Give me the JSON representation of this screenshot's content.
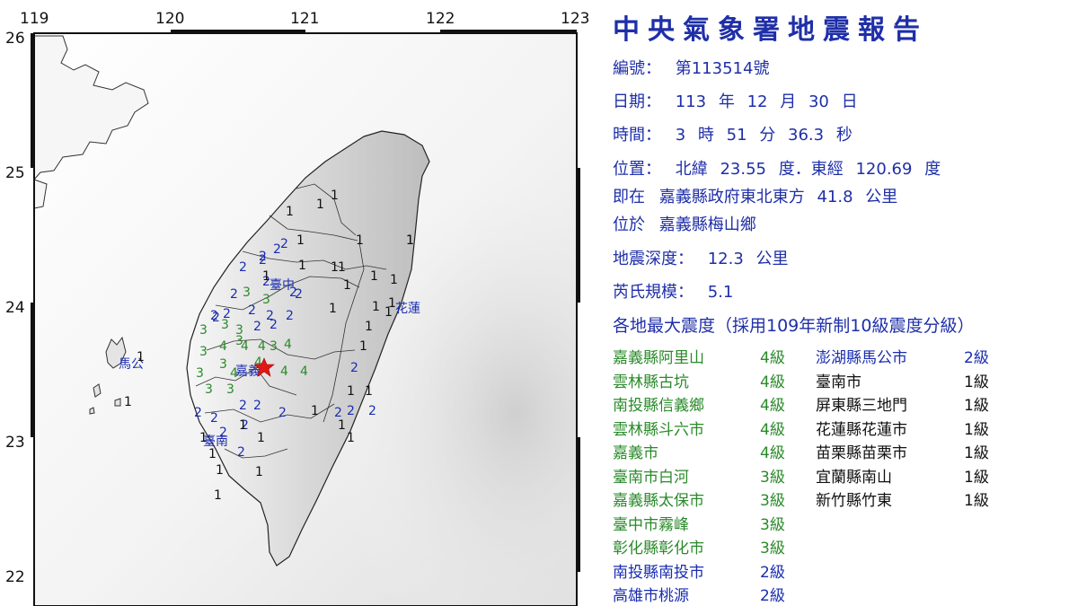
{
  "map": {
    "lon_ticks": [
      "119",
      "120",
      "121",
      "122",
      "123"
    ],
    "lat_ticks": [
      "26",
      "25",
      "24",
      "23",
      "22"
    ],
    "cities": [
      "臺中",
      "花蓮",
      "嘉義",
      "臺南",
      "馬公"
    ],
    "colors": {
      "level4": "#2a8a2a",
      "level3": "#2a8a2a",
      "level2": "#1a2db0",
      "level1": "#111111",
      "epicenter": "#e01818"
    },
    "intensity_marks": [
      "4",
      "4",
      "4",
      "4",
      "4",
      "4",
      "4",
      "4",
      "3",
      "3",
      "3",
      "3",
      "3",
      "3",
      "3",
      "3",
      "3",
      "3",
      "3",
      "3",
      "2",
      "2",
      "2",
      "2",
      "2",
      "2",
      "2",
      "2",
      "2",
      "2",
      "2",
      "2",
      "2",
      "2",
      "2",
      "2",
      "2",
      "2",
      "2",
      "2",
      "2",
      "2",
      "2",
      "2",
      "2",
      "2",
      "2",
      "2",
      "2",
      "1",
      "1",
      "1",
      "1",
      "1",
      "1",
      "1",
      "1",
      "1",
      "1",
      "1",
      "1",
      "1",
      "1",
      "1",
      "1",
      "1",
      "1",
      "1",
      "1",
      "1",
      "1",
      "1",
      "1",
      "1",
      "1",
      "1",
      "1",
      "1",
      "1",
      "1",
      "1",
      "1",
      "1"
    ]
  },
  "report": {
    "title": "中央氣象署地震報告",
    "number_label": "編號：",
    "number": "第113514號",
    "date_label": "日期：",
    "date_year": "113",
    "date_year_unit": "年",
    "date_month": "12",
    "date_month_unit": "月",
    "date_day": "30",
    "date_day_unit": "日",
    "time_label": "時間：",
    "time_h": "3",
    "time_h_unit": "時",
    "time_m": "51",
    "time_m_unit": "分",
    "time_s": "36.3",
    "time_s_unit": "秒",
    "location_label": "位置：",
    "lat_prefix": "北緯",
    "lat": "23.55",
    "lat_unit": "度．東經",
    "lon": "120.69",
    "lon_unit": "度",
    "ref_label": "即在",
    "ref_place": "嘉義縣政府東北東方",
    "ref_distance": "41.8",
    "ref_unit": "公里",
    "at_label": "位於",
    "at_place": "嘉義縣梅山鄉",
    "depth_label": "地震深度：",
    "depth": "12.3",
    "depth_unit": "公里",
    "magnitude_label": "芮氏規模：",
    "magnitude": "5.1",
    "intensity_heading": "各地最大震度（採用109年新制10級震度分級）",
    "intensity_list_left": [
      {
        "place": "嘉義縣阿里山",
        "level": "4級",
        "color": "#2a8a2a"
      },
      {
        "place": "雲林縣古坑",
        "level": "4級",
        "color": "#2a8a2a"
      },
      {
        "place": "南投縣信義鄉",
        "level": "4級",
        "color": "#2a8a2a"
      },
      {
        "place": "雲林縣斗六市",
        "level": "4級",
        "color": "#2a8a2a"
      },
      {
        "place": "嘉義市",
        "level": "4級",
        "color": "#2a8a2a"
      },
      {
        "place": "臺南市白河",
        "level": "3級",
        "color": "#2a8a2a"
      },
      {
        "place": "嘉義縣太保市",
        "level": "3級",
        "color": "#2a8a2a"
      },
      {
        "place": "臺中市霧峰",
        "level": "3級",
        "color": "#2a8a2a"
      },
      {
        "place": "彰化縣彰化市",
        "level": "3級",
        "color": "#2a8a2a"
      },
      {
        "place": "南投縣南投市",
        "level": "2級",
        "color": "#1a2db0"
      },
      {
        "place": "高雄市桃源",
        "level": "2級",
        "color": "#1a2db0"
      }
    ],
    "intensity_list_right": [
      {
        "place": "澎湖縣馬公市",
        "level": "2級",
        "color": "#1a2db0"
      },
      {
        "place": "臺南市",
        "level": "1級",
        "color": "#111111"
      },
      {
        "place": "屏東縣三地門",
        "level": "1級",
        "color": "#111111"
      },
      {
        "place": "花蓮縣花蓮市",
        "level": "1級",
        "color": "#111111"
      },
      {
        "place": "苗栗縣苗栗市",
        "level": "1級",
        "color": "#111111"
      },
      {
        "place": "宜蘭縣南山",
        "level": "1級",
        "color": "#111111"
      },
      {
        "place": "新竹縣竹東",
        "level": "1級",
        "color": "#111111"
      }
    ]
  }
}
